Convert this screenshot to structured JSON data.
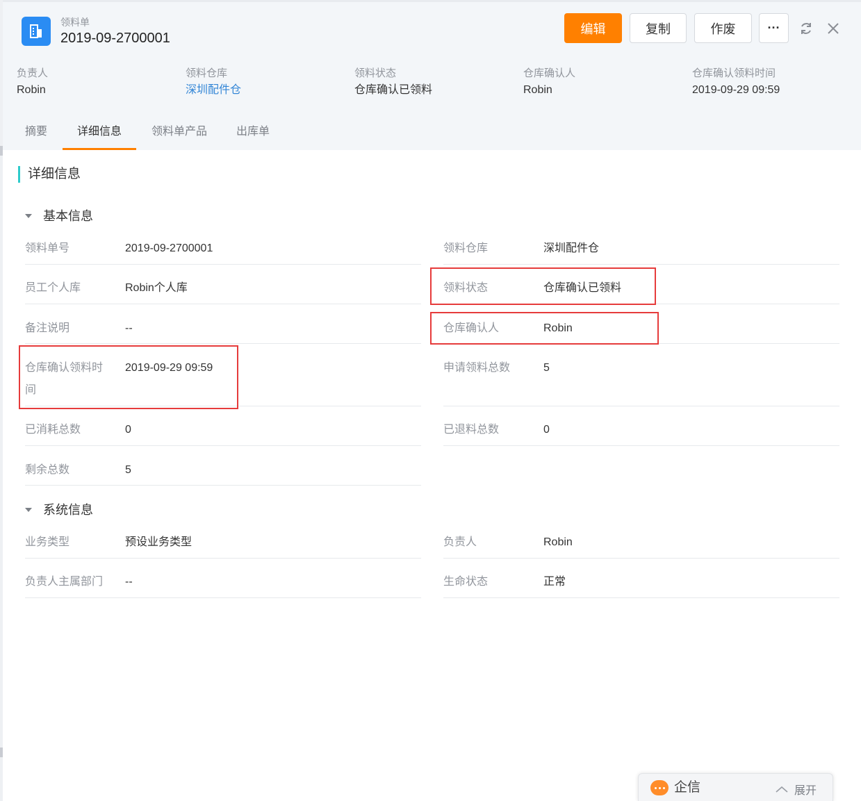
{
  "object": {
    "type_label": "领料单",
    "title": "2019-09-2700001",
    "icon": "building-icon"
  },
  "toolbar": {
    "edit_label": "编辑",
    "copy_label": "复制",
    "void_label": "作废",
    "more_label": "···"
  },
  "summary": [
    {
      "label": "负责人",
      "value": "Robin"
    },
    {
      "label": "领料仓库",
      "value": "深圳配件仓"
    },
    {
      "label": "领料状态",
      "value": "仓库确认已领料"
    },
    {
      "label": "仓库确认人",
      "value": "Robin"
    },
    {
      "label": "仓库确认领料时间",
      "value": "2019-09-29 09:59"
    }
  ],
  "tabs": [
    "摘要",
    "详细信息",
    "领料单产品",
    "出库单"
  ],
  "active_tab": "详细信息",
  "section_title": "详细信息",
  "basic": {
    "title": "基本信息",
    "fields": {
      "order_no": {
        "label": "领料单号",
        "value": "2019-09-2700001"
      },
      "warehouse": {
        "label": "领料仓库",
        "value": "深圳配件仓"
      },
      "personal_store": {
        "label": "员工个人库",
        "value": "Robin个人库"
      },
      "status": {
        "label": "领料状态",
        "value": "仓库确认已领料"
      },
      "remark": {
        "label": "备注说明",
        "value": "--"
      },
      "confirmer": {
        "label": "仓库确认人",
        "value": "Robin"
      },
      "confirm_time": {
        "label_line1": "仓库确认领料时",
        "label_line2": "间",
        "value": "2019-09-29 09:59"
      },
      "requested_total": {
        "label": "申请领料总数",
        "value": "5"
      },
      "consumed_total": {
        "label": "已消耗总数",
        "value": "0"
      },
      "returned_total": {
        "label": "已退料总数",
        "value": "0"
      },
      "remaining_total": {
        "label": "剩余总数",
        "value": "5"
      }
    }
  },
  "system": {
    "title": "系统信息",
    "fields": {
      "biz_type": {
        "label": "业务类型",
        "value": "预设业务类型"
      },
      "owner": {
        "label": "负责人",
        "value": "Robin"
      },
      "owner_dept": {
        "label": "负责人主属部门",
        "value": "--"
      },
      "life_status": {
        "label": "生命状态",
        "value": "正常"
      }
    }
  },
  "chat": {
    "label": "企信",
    "expand_label": "展开"
  },
  "colors": {
    "accent": "#ff8000",
    "link": "#3386d6",
    "highlight": "#e63b3b",
    "section_bar": "#2ecbcb",
    "object_icon": "#2a8cf3"
  }
}
